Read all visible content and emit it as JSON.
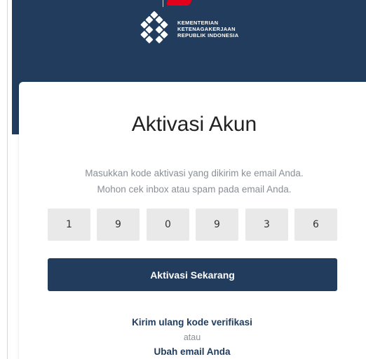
{
  "header": {
    "logo_icon": "ministry-logo-icon",
    "org_name_lines": [
      "KEMENTERIAN",
      "KETENAGAKERJAAN",
      "REPUBLIK INDONESIA"
    ]
  },
  "page": {
    "title": "Aktivasi Akun",
    "instruction_line1": "Masukkan kode aktivasi yang dikirim ke email Anda.",
    "instruction_line2": "Mohon cek inbox atau spam pada email Anda."
  },
  "code_inputs": [
    "1",
    "9",
    "0",
    "9",
    "3",
    "6"
  ],
  "actions": {
    "activate_label": "Aktivasi Sekarang",
    "resend_label": "Kirim ulang kode verifikasi",
    "or_label": "atau",
    "change_email_label": "Ubah email Anda"
  },
  "colors": {
    "primary": "#213c5c",
    "input_bg": "#e9e9e9",
    "muted_text": "#8a8f95",
    "accent": "#e3001b"
  }
}
